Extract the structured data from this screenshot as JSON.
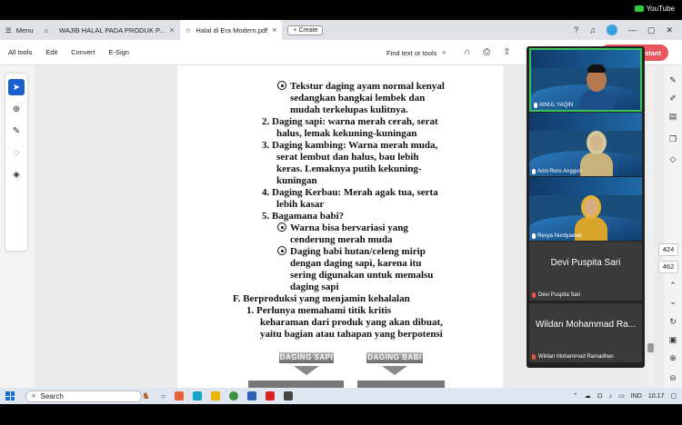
{
  "overlay": {
    "channel": "YouTube"
  },
  "browser": {
    "menu_label": "Menu",
    "tabs": [
      {
        "title": "WAJIB HALAL PADA PRODUK P..."
      },
      {
        "title": "Halal di Era Modern.pdf"
      }
    ],
    "create_label": "Create"
  },
  "toolbar": {
    "items": [
      "All tools",
      "Edit",
      "Convert",
      "E-Sign"
    ],
    "find_label": "Find text or tools",
    "assistant_label": "Assistant"
  },
  "document": {
    "lines": [
      "Tekstur daging ayam normal kenyal",
      "sedangkan bangkai lembek dan",
      "mudah terkelupas kulitnya.",
      "2.  Daging sapi: warna merah cerah, serat",
      "halus, lemak kekuning-kuningan",
      "3.  Daging kambing: Warna merah muda,",
      "serat lembut dan halus, bau lebih",
      "keras. Lemaknya putih kekuning-",
      "kuningan",
      "4.  Daging Kerbau: Merah agak tua, serta",
      "lebih kasar",
      "5.  Bagamana babi?",
      "Warna bisa bervariasi yang",
      "cenderung merah muda",
      "Daging babi hutan/celeng mirip",
      "dengan daging sapi, karena itu",
      "sering digunakan untuk memalsu",
      "daging sapi",
      "F.  Berproduksi  yang menjamin kehalalan",
      "1.  Perlunya memahami titik kritis",
      "keharaman dari produk yang akan dibuat,",
      "yaitu bagian atau tahapan yang berpotensi"
    ],
    "image_labels": [
      "DAGING SAPI",
      "DAGING BABI"
    ]
  },
  "page_numbers": {
    "current": "424",
    "total": "462"
  },
  "meeting": {
    "participants": [
      {
        "name": "AINUL YAQIN"
      },
      {
        "name": "Arini Roro Anggun"
      },
      {
        "name": "Resya Nurdyawati"
      }
    ],
    "tiles": [
      {
        "display_name": "Devi Puspita Sari",
        "label": "Devi Puspita Sari"
      },
      {
        "display_name": "Wildan Mohammad Ra...",
        "label": "Wildan Mohammad Ramadhan"
      }
    ]
  },
  "taskbar": {
    "search_placeholder": "Search",
    "language": "IND",
    "time": "10.17"
  },
  "colors": {
    "accent": "#1b5ed0",
    "assistant": "#e9565e",
    "active_speaker": "#37c35d"
  }
}
